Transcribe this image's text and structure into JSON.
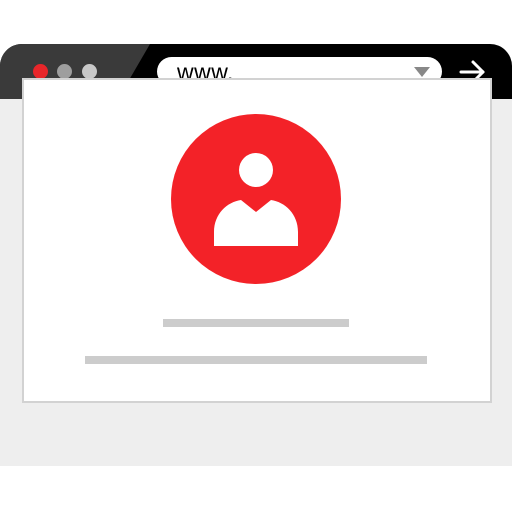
{
  "browser": {
    "address_bar": {
      "url": "www.",
      "dropdown_icon": "chevron-down-icon",
      "go_icon": "arrow-right-icon"
    },
    "window_controls": {
      "close_color": "#e8262a",
      "minimize_color": "#9e9e9e",
      "maximize_color": "#c8c8c8"
    }
  },
  "content": {
    "avatar": {
      "icon": "user-icon",
      "background_color": "#f32228"
    },
    "text_placeholders": {
      "color": "#cccccc",
      "count": 2
    }
  },
  "colors": {
    "titlebar": "#000000",
    "titlebar_left": "#3a3a3a",
    "window_background": "#eeeeee",
    "accent": "#f32228"
  }
}
